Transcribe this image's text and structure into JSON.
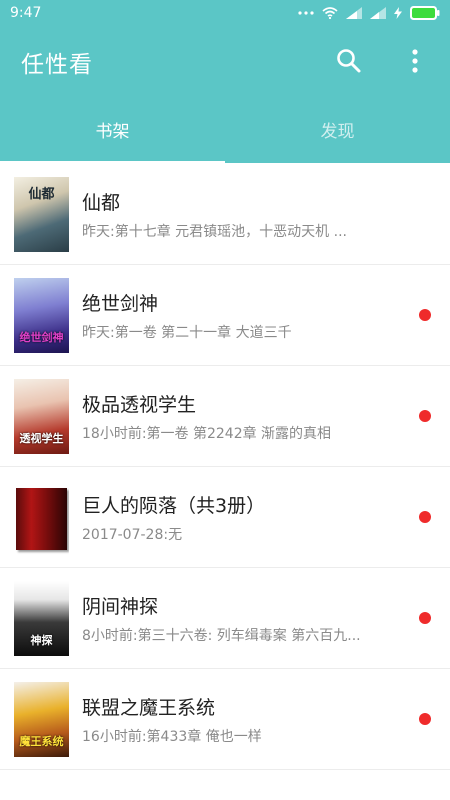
{
  "status": {
    "time": "9:47"
  },
  "app": {
    "title": "任性看"
  },
  "tabs": [
    {
      "label": "书架"
    },
    {
      "label": "发现"
    }
  ],
  "books": [
    {
      "title": "仙都",
      "subtitle": "昨天:第十七章 元君镇瑶池，十恶动天机 ...",
      "cover_text": "仙都",
      "has_update": false
    },
    {
      "title": "绝世剑神",
      "subtitle": "昨天:第一卷 第二十一章 大道三千",
      "cover_text": "绝世剑神",
      "has_update": true
    },
    {
      "title": "极品透视学生",
      "subtitle": "18小时前:第一卷 第2242章 渐露的真相",
      "cover_text": "透视学生",
      "has_update": true
    },
    {
      "title": "巨人的陨落（共3册）",
      "subtitle": "2017-07-28:无",
      "cover_text": "",
      "has_update": true
    },
    {
      "title": "阴间神探",
      "subtitle": "8小时前:第三十六卷: 列车缉毒案 第六百九...",
      "cover_text": "神探",
      "has_update": true
    },
    {
      "title": "联盟之魔王系统",
      "subtitle": "16小时前:第433章 俺也一样",
      "cover_text": "魔王系统",
      "has_update": true
    }
  ],
  "colors": {
    "primary": "#5bc6c6",
    "update_dot": "#ef2b2b"
  }
}
